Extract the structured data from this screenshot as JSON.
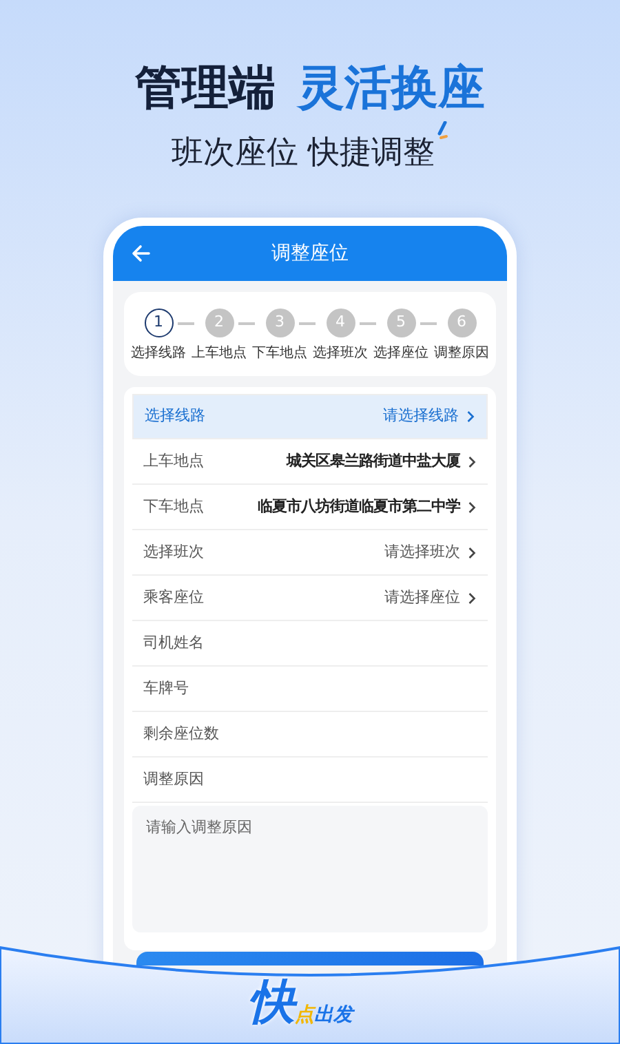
{
  "headline": {
    "dark": "管理端",
    "accent": "灵活换座"
  },
  "subtitle": "班次座位 快捷调整",
  "app": {
    "title": "调整座位",
    "steps": [
      {
        "number": "1",
        "label": "选择线路",
        "selected": true
      },
      {
        "number": "2",
        "label": "上车地点",
        "selected": false
      },
      {
        "number": "3",
        "label": "下车地点",
        "selected": false
      },
      {
        "number": "4",
        "label": "选择班次",
        "selected": false
      },
      {
        "number": "5",
        "label": "选择座位",
        "selected": false
      },
      {
        "number": "6",
        "label": "调整原因",
        "selected": false
      }
    ],
    "fields": [
      {
        "kind": "select",
        "label": "选择线路",
        "placeholder": "请选择线路",
        "selected": true
      },
      {
        "kind": "select",
        "label": "上车地点",
        "value": "城关区皋兰路街道中盐大厦",
        "selected": false
      },
      {
        "kind": "select",
        "label": "下车地点",
        "value": "临夏市八坊街道临夏市第二中学",
        "selected": false
      },
      {
        "kind": "select",
        "label": "选择班次",
        "placeholder": "请选择班次",
        "selected": false
      },
      {
        "kind": "select",
        "label": "乘客座位",
        "placeholder": "请选择座位",
        "selected": false
      },
      {
        "kind": "text",
        "label": "司机姓名",
        "selected": false
      },
      {
        "kind": "text",
        "label": "车牌号",
        "selected": false
      },
      {
        "kind": "text",
        "label": "剩余座位数",
        "selected": false
      },
      {
        "kind": "text",
        "label": "调整原因",
        "selected": false
      }
    ],
    "reason_placeholder": "请输入调整原因"
  },
  "logo": {
    "main": "快",
    "dot": "点",
    "rest": "出发"
  }
}
